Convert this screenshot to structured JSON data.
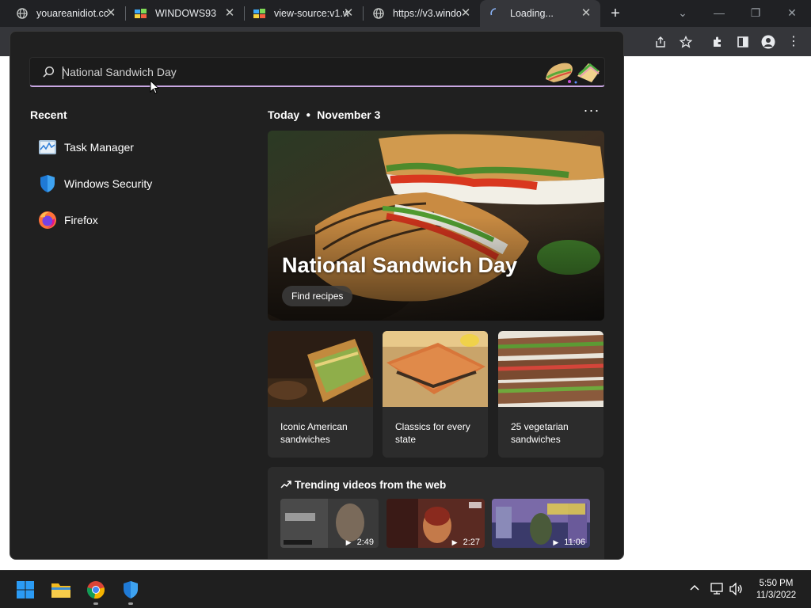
{
  "browser": {
    "tabs": [
      {
        "title": "youareanidiot.cc",
        "icon": "globe-icon"
      },
      {
        "title": "WINDOWS93",
        "icon": "windows93-icon"
      },
      {
        "title": "view-source:v1.w",
        "icon": "windows93-icon"
      },
      {
        "title": "https://v3.windo",
        "icon": "globe-icon"
      },
      {
        "title": "Loading...",
        "icon": "loading-spinner-icon"
      }
    ],
    "new_tab_label": "+"
  },
  "search": {
    "query": "National Sandwich Day"
  },
  "recent": {
    "heading": "Recent",
    "items": [
      {
        "label": "Task Manager",
        "icon": "task-manager-icon"
      },
      {
        "label": "Windows Security",
        "icon": "windows-security-icon"
      },
      {
        "label": "Firefox",
        "icon": "firefox-icon"
      }
    ]
  },
  "today": {
    "label": "Today",
    "date": "November 3",
    "more_label": "···"
  },
  "hero": {
    "title": "National Sandwich Day",
    "button": "Find recipes"
  },
  "cards": [
    {
      "line1": "Iconic American",
      "line2": "sandwiches"
    },
    {
      "line1": "Classics for every",
      "line2": "state"
    },
    {
      "line1": "25 vegetarian",
      "line2": "sandwiches"
    }
  ],
  "trending": {
    "heading": "Trending videos from the web",
    "videos": [
      {
        "duration": "2:49"
      },
      {
        "duration": "2:27"
      },
      {
        "duration": "11:06"
      }
    ]
  },
  "taskbar": {
    "time": "5:50 PM",
    "date": "11/3/2022"
  },
  "colors": {
    "accent_underline": "#c9a7e3",
    "panel_bg": "#202020",
    "card_bg": "#2c2c2c"
  }
}
